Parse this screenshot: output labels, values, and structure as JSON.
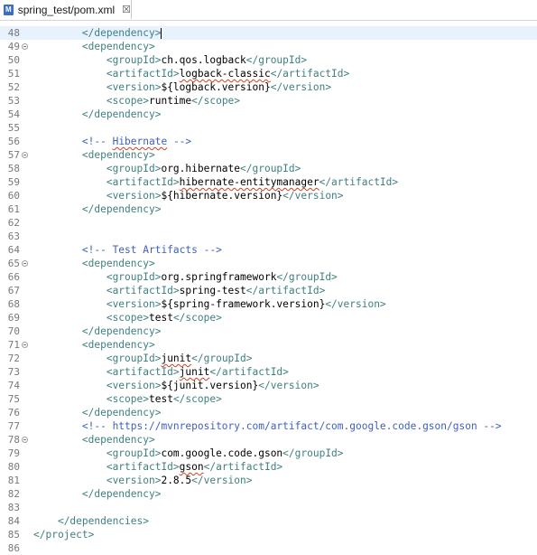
{
  "tab": {
    "title": "spring_test/pom.xml",
    "icon": "maven-xml-file-icon",
    "close": "☒"
  },
  "colors": {
    "tag": "#3f7f7f",
    "comment": "#3f5fbf",
    "text": "#000000",
    "line_number": "#787878"
  },
  "lines": [
    {
      "n": "48",
      "fold": false,
      "cursor": true,
      "parts": [
        {
          "t": "        ",
          "c": "txt"
        },
        {
          "t": "</dependency>",
          "c": "tag"
        }
      ]
    },
    {
      "n": "49",
      "fold": true,
      "parts": [
        {
          "t": "        ",
          "c": "txt"
        },
        {
          "t": "<dependency>",
          "c": "tag"
        }
      ]
    },
    {
      "n": "50",
      "fold": false,
      "parts": [
        {
          "t": "            ",
          "c": "txt"
        },
        {
          "t": "<groupId>",
          "c": "tag"
        },
        {
          "t": "ch.qos.logback",
          "c": "txt"
        },
        {
          "t": "</groupId>",
          "c": "tag"
        }
      ]
    },
    {
      "n": "51",
      "fold": false,
      "parts": [
        {
          "t": "            ",
          "c": "txt"
        },
        {
          "t": "<artifactId>",
          "c": "tag"
        },
        {
          "t": "logback-classic",
          "c": "txt",
          "sq": true
        },
        {
          "t": "</artifactId>",
          "c": "tag"
        }
      ]
    },
    {
      "n": "52",
      "fold": false,
      "parts": [
        {
          "t": "            ",
          "c": "txt"
        },
        {
          "t": "<version>",
          "c": "tag"
        },
        {
          "t": "${logback.version}",
          "c": "txt"
        },
        {
          "t": "</version>",
          "c": "tag"
        }
      ]
    },
    {
      "n": "53",
      "fold": false,
      "parts": [
        {
          "t": "            ",
          "c": "txt"
        },
        {
          "t": "<scope>",
          "c": "tag"
        },
        {
          "t": "runtime",
          "c": "txt"
        },
        {
          "t": "</scope>",
          "c": "tag"
        }
      ]
    },
    {
      "n": "54",
      "fold": false,
      "parts": [
        {
          "t": "        ",
          "c": "txt"
        },
        {
          "t": "</dependency>",
          "c": "tag"
        }
      ]
    },
    {
      "n": "55",
      "fold": false,
      "parts": []
    },
    {
      "n": "56",
      "fold": false,
      "parts": [
        {
          "t": "        ",
          "c": "txt"
        },
        {
          "t": "<!-- ",
          "c": "cmt"
        },
        {
          "t": "Hibernate",
          "c": "cmt",
          "sq": true
        },
        {
          "t": " -->",
          "c": "cmt"
        }
      ]
    },
    {
      "n": "57",
      "fold": true,
      "parts": [
        {
          "t": "        ",
          "c": "txt"
        },
        {
          "t": "<dependency>",
          "c": "tag"
        }
      ]
    },
    {
      "n": "58",
      "fold": false,
      "parts": [
        {
          "t": "            ",
          "c": "txt"
        },
        {
          "t": "<groupId>",
          "c": "tag"
        },
        {
          "t": "org.hibernate",
          "c": "txt"
        },
        {
          "t": "</groupId>",
          "c": "tag"
        }
      ]
    },
    {
      "n": "59",
      "fold": false,
      "parts": [
        {
          "t": "            ",
          "c": "txt"
        },
        {
          "t": "<artifactId>",
          "c": "tag"
        },
        {
          "t": "hibernate-entitymanager",
          "c": "txt",
          "sq": true
        },
        {
          "t": "</artifactId>",
          "c": "tag"
        }
      ]
    },
    {
      "n": "60",
      "fold": false,
      "parts": [
        {
          "t": "            ",
          "c": "txt"
        },
        {
          "t": "<version>",
          "c": "tag"
        },
        {
          "t": "${hibernate.version}",
          "c": "txt"
        },
        {
          "t": "</version>",
          "c": "tag"
        }
      ]
    },
    {
      "n": "61",
      "fold": false,
      "parts": [
        {
          "t": "        ",
          "c": "txt"
        },
        {
          "t": "</dependency>",
          "c": "tag"
        }
      ]
    },
    {
      "n": "62",
      "fold": false,
      "parts": []
    },
    {
      "n": "63",
      "fold": false,
      "parts": []
    },
    {
      "n": "64",
      "fold": false,
      "parts": [
        {
          "t": "        ",
          "c": "txt"
        },
        {
          "t": "<!-- Test Artifacts -->",
          "c": "cmt"
        }
      ]
    },
    {
      "n": "65",
      "fold": true,
      "parts": [
        {
          "t": "        ",
          "c": "txt"
        },
        {
          "t": "<dependency>",
          "c": "tag"
        }
      ]
    },
    {
      "n": "66",
      "fold": false,
      "parts": [
        {
          "t": "            ",
          "c": "txt"
        },
        {
          "t": "<groupId>",
          "c": "tag"
        },
        {
          "t": "org.springframework",
          "c": "txt"
        },
        {
          "t": "</groupId>",
          "c": "tag"
        }
      ]
    },
    {
      "n": "67",
      "fold": false,
      "parts": [
        {
          "t": "            ",
          "c": "txt"
        },
        {
          "t": "<artifactId>",
          "c": "tag"
        },
        {
          "t": "spring-test",
          "c": "txt"
        },
        {
          "t": "</artifactId>",
          "c": "tag"
        }
      ]
    },
    {
      "n": "68",
      "fold": false,
      "parts": [
        {
          "t": "            ",
          "c": "txt"
        },
        {
          "t": "<version>",
          "c": "tag"
        },
        {
          "t": "${spring-framework.version}",
          "c": "txt"
        },
        {
          "t": "</version>",
          "c": "tag"
        }
      ]
    },
    {
      "n": "69",
      "fold": false,
      "parts": [
        {
          "t": "            ",
          "c": "txt"
        },
        {
          "t": "<scope>",
          "c": "tag"
        },
        {
          "t": "test",
          "c": "txt"
        },
        {
          "t": "</scope>",
          "c": "tag"
        }
      ]
    },
    {
      "n": "70",
      "fold": false,
      "parts": [
        {
          "t": "        ",
          "c": "txt"
        },
        {
          "t": "</dependency>",
          "c": "tag"
        }
      ]
    },
    {
      "n": "71",
      "fold": true,
      "parts": [
        {
          "t": "        ",
          "c": "txt"
        },
        {
          "t": "<dependency>",
          "c": "tag"
        }
      ]
    },
    {
      "n": "72",
      "fold": false,
      "parts": [
        {
          "t": "            ",
          "c": "txt"
        },
        {
          "t": "<groupId>",
          "c": "tag"
        },
        {
          "t": "junit",
          "c": "txt",
          "sq": true
        },
        {
          "t": "</groupId>",
          "c": "tag"
        }
      ]
    },
    {
      "n": "73",
      "fold": false,
      "parts": [
        {
          "t": "            ",
          "c": "txt"
        },
        {
          "t": "<artifactId>",
          "c": "tag"
        },
        {
          "t": "junit",
          "c": "txt",
          "sq": true
        },
        {
          "t": "</artifactId>",
          "c": "tag"
        }
      ]
    },
    {
      "n": "74",
      "fold": false,
      "parts": [
        {
          "t": "            ",
          "c": "txt"
        },
        {
          "t": "<version>",
          "c": "tag"
        },
        {
          "t": "${junit.version}",
          "c": "txt"
        },
        {
          "t": "</version>",
          "c": "tag"
        }
      ]
    },
    {
      "n": "75",
      "fold": false,
      "parts": [
        {
          "t": "            ",
          "c": "txt"
        },
        {
          "t": "<scope>",
          "c": "tag"
        },
        {
          "t": "test",
          "c": "txt"
        },
        {
          "t": "</scope>",
          "c": "tag"
        }
      ]
    },
    {
      "n": "76",
      "fold": false,
      "parts": [
        {
          "t": "        ",
          "c": "txt"
        },
        {
          "t": "</dependency>",
          "c": "tag"
        }
      ]
    },
    {
      "n": "77",
      "fold": false,
      "parts": [
        {
          "t": "        ",
          "c": "txt"
        },
        {
          "t": "<!-- https://mvnrepository.com/artifact/com.google.code.gson/gson -->",
          "c": "cmt"
        }
      ]
    },
    {
      "n": "78",
      "fold": true,
      "parts": [
        {
          "t": "        ",
          "c": "txt"
        },
        {
          "t": "<dependency>",
          "c": "tag"
        }
      ]
    },
    {
      "n": "79",
      "fold": false,
      "parts": [
        {
          "t": "            ",
          "c": "txt"
        },
        {
          "t": "<groupId>",
          "c": "tag"
        },
        {
          "t": "com.google.code.gson",
          "c": "txt"
        },
        {
          "t": "</groupId>",
          "c": "tag"
        }
      ]
    },
    {
      "n": "80",
      "fold": false,
      "parts": [
        {
          "t": "            ",
          "c": "txt"
        },
        {
          "t": "<artifactId>",
          "c": "tag"
        },
        {
          "t": "gson",
          "c": "txt",
          "sq": true
        },
        {
          "t": "</artifactId>",
          "c": "tag"
        }
      ]
    },
    {
      "n": "81",
      "fold": false,
      "parts": [
        {
          "t": "            ",
          "c": "txt"
        },
        {
          "t": "<version>",
          "c": "tag"
        },
        {
          "t": "2.8.5",
          "c": "txt"
        },
        {
          "t": "</version>",
          "c": "tag"
        }
      ]
    },
    {
      "n": "82",
      "fold": false,
      "parts": [
        {
          "t": "        ",
          "c": "txt"
        },
        {
          "t": "</dependency>",
          "c": "tag"
        }
      ]
    },
    {
      "n": "83",
      "fold": false,
      "parts": []
    },
    {
      "n": "84",
      "fold": false,
      "parts": [
        {
          "t": "    ",
          "c": "txt"
        },
        {
          "t": "</dependencies>",
          "c": "tag"
        }
      ]
    },
    {
      "n": "85",
      "fold": false,
      "parts": [
        {
          "t": "</project>",
          "c": "tag"
        }
      ]
    },
    {
      "n": "86",
      "fold": false,
      "parts": []
    }
  ]
}
